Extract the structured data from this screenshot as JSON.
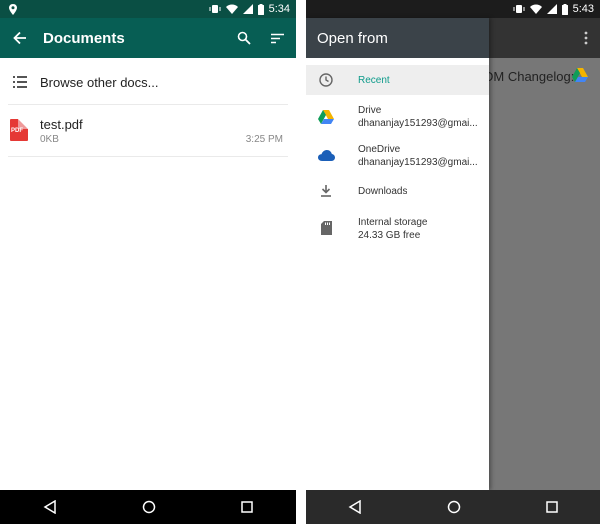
{
  "left_screen": {
    "status": {
      "time": "5:34"
    },
    "appbar": {
      "title": "Documents"
    },
    "browse_label": "Browse other docs...",
    "files": [
      {
        "icon": "pdf-file-icon",
        "icon_label": "PDF",
        "name": "test.pdf",
        "size": "0KB",
        "time": "3:25 PM"
      }
    ]
  },
  "right_screen": {
    "status": {
      "time": "5:43"
    },
    "background_row_text": "DM Changelog:",
    "drawer": {
      "title": "Open from",
      "items": [
        {
          "icon": "clock-icon",
          "title": "Recent",
          "subtitle": "",
          "selected": true
        },
        {
          "icon": "google-drive-icon",
          "title": "Drive",
          "subtitle": "dhananjay151293@gmai..."
        },
        {
          "icon": "onedrive-icon",
          "title": "OneDrive",
          "subtitle": "dhananjay151293@gmai..."
        },
        {
          "icon": "download-icon",
          "title": "Downloads",
          "subtitle": ""
        },
        {
          "icon": "sd-card-icon",
          "title": "Internal storage",
          "subtitle": "24.33 GB free"
        }
      ]
    }
  },
  "colors": {
    "appbar": "#075e54",
    "statusbar": "#0a4f44",
    "drawer_header": "#3b4349",
    "accent": "#0e9b8b",
    "pdf_red": "#e53935"
  }
}
